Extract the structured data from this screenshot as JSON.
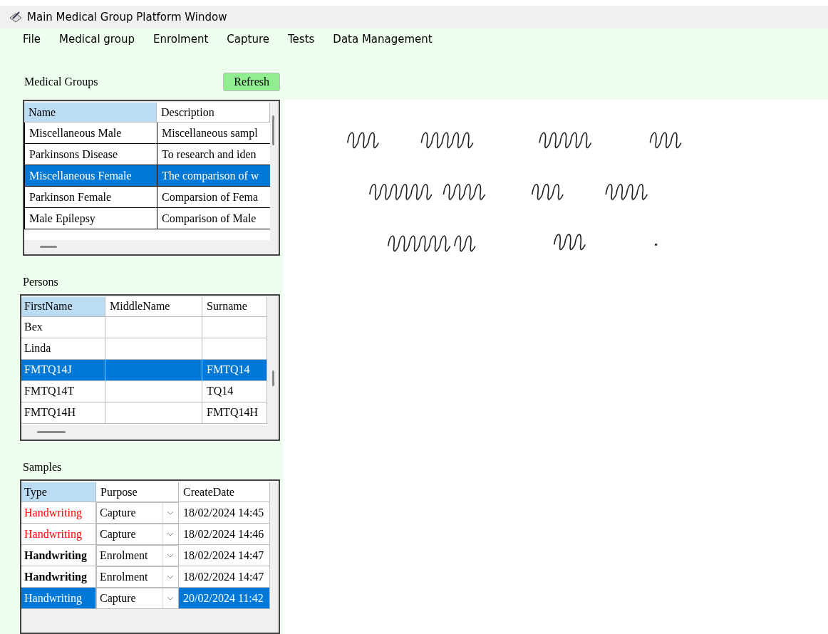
{
  "window": {
    "title": "Main Medical Group Platform Window"
  },
  "menu": [
    "File",
    "Medical group",
    "Enrolment",
    "Capture",
    "Tests",
    "Data Management"
  ],
  "medical_groups": {
    "label": "Medical Groups",
    "refresh_button": "Refresh",
    "columns": [
      {
        "label": "Name",
        "selected": true
      },
      {
        "label": "Description",
        "selected": false
      }
    ],
    "rows": [
      {
        "cells": [
          "Miscellaneous Male",
          "Miscellaneous sampl"
        ],
        "selected": false
      },
      {
        "cells": [
          "Parkinsons Disease",
          "To research and iden"
        ],
        "selected": false
      },
      {
        "cells": [
          "Miscellaneous Female",
          "The comparison of w"
        ],
        "selected": true
      },
      {
        "cells": [
          "Parkinson Female",
          "Comparsion of  Fema"
        ],
        "selected": false
      },
      {
        "cells": [
          "Male Epilepsy",
          "Comparison of Male"
        ],
        "selected": false
      }
    ]
  },
  "persons": {
    "label": "Persons",
    "columns": [
      {
        "label": "FirstName",
        "selected": true
      },
      {
        "label": "MiddleName",
        "selected": false
      },
      {
        "label": "Surname",
        "selected": false
      }
    ],
    "rows": [
      {
        "cells": [
          "Bex",
          "",
          ""
        ],
        "selected": false
      },
      {
        "cells": [
          "Linda",
          "",
          ""
        ],
        "selected": false
      },
      {
        "cells": [
          "FMTQ14J",
          "",
          "FMTQ14"
        ],
        "selected": true
      },
      {
        "cells": [
          "FMTQ14T",
          "",
          "TQ14"
        ],
        "selected": false
      },
      {
        "cells": [
          "FMTQ14H",
          "",
          "FMTQ14H"
        ],
        "selected": false
      }
    ]
  },
  "samples": {
    "label": "Samples",
    "columns": [
      {
        "label": "Type",
        "selected": true
      },
      {
        "label": "Purpose",
        "selected": false
      },
      {
        "label": "CreateDate",
        "selected": false
      }
    ],
    "rows": [
      {
        "type": "Handwriting",
        "color": "#ff0000",
        "bold": false,
        "purpose": "Capture",
        "create_date": "18/02/2024 14:45",
        "selected": false
      },
      {
        "type": "Handwriting",
        "color": "#ff0000",
        "bold": false,
        "purpose": "Capture",
        "create_date": "18/02/2024 14:46",
        "selected": false
      },
      {
        "type": "Handwriting",
        "color": "#000000",
        "bold": true,
        "purpose": "Enrolment",
        "create_date": "18/02/2024 14:47",
        "selected": false
      },
      {
        "type": "Handwriting",
        "color": "#000000",
        "bold": true,
        "purpose": "Enrolment",
        "create_date": "18/02/2024 14:47",
        "selected": false
      },
      {
        "type": "Handwriting",
        "bold": false,
        "purpose": "Capture",
        "create_date": "20/02/2024 11:42",
        "selected": true
      }
    ]
  }
}
